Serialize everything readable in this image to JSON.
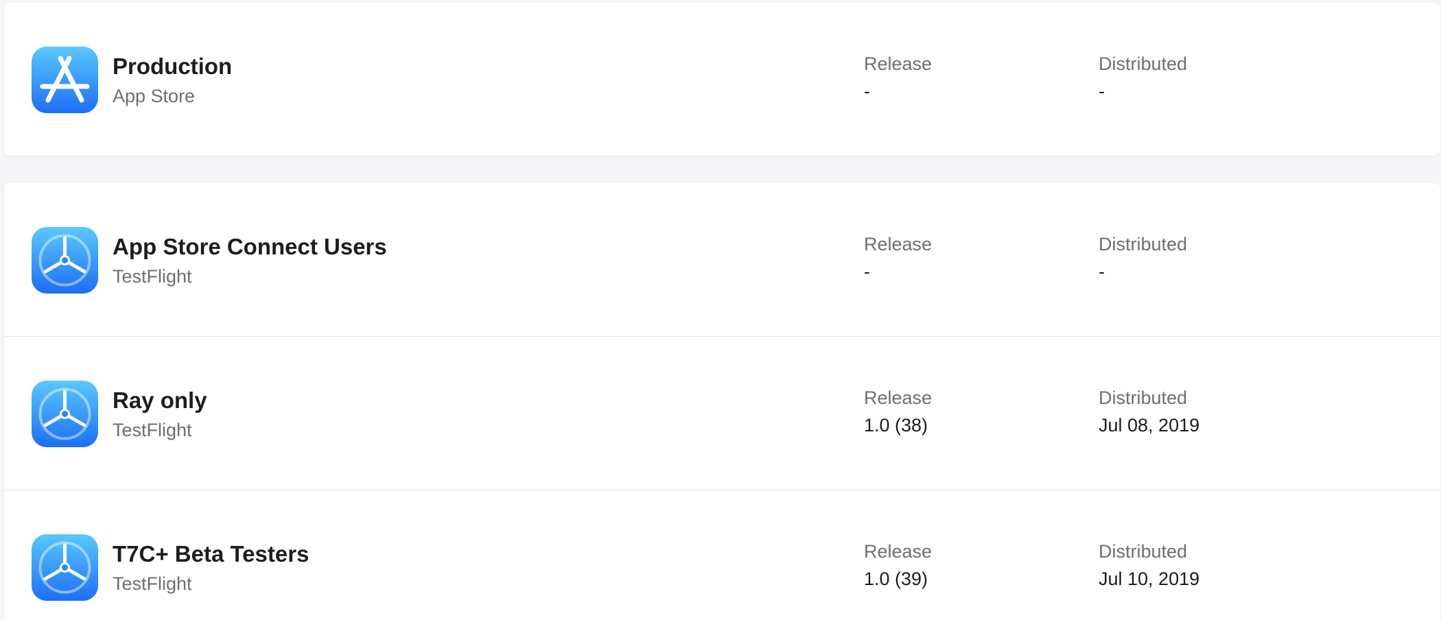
{
  "columns": {
    "release_label": "Release",
    "distributed_label": "Distributed"
  },
  "production": {
    "name": "Production",
    "subtitle": "App Store",
    "icon": "app-store-icon",
    "release": "-",
    "distributed": "-"
  },
  "testflight_groups": [
    {
      "name": "App Store Connect Users",
      "subtitle": "TestFlight",
      "icon": "testflight-icon",
      "release": "-",
      "distributed": "-"
    },
    {
      "name": "Ray only",
      "subtitle": "TestFlight",
      "icon": "testflight-icon",
      "release": "1.0 (38)",
      "distributed": "Jul 08, 2019"
    },
    {
      "name": "T7C+ Beta Testers",
      "subtitle": "TestFlight",
      "icon": "testflight-icon",
      "release": "1.0 (39)",
      "distributed": "Jul 10, 2019"
    }
  ],
  "colors": {
    "icon_gradient_top": "#5ac8fa",
    "icon_gradient_bottom": "#1e6ef5",
    "accent_text": "#1d1d1f",
    "muted_text": "#6e6e73"
  }
}
